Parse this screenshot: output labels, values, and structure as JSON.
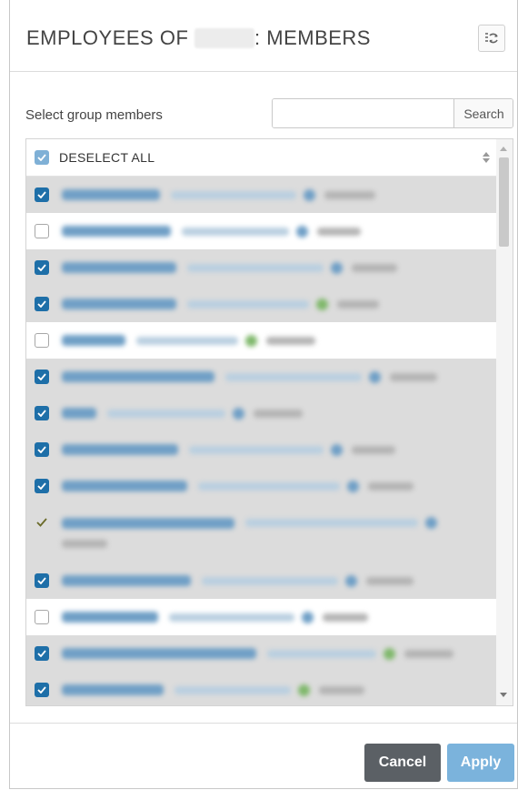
{
  "dialog": {
    "title_prefix": "EMPLOYEES OF",
    "title_suffix": ": MEMBERS",
    "refresh_icon": "refresh-icon"
  },
  "search": {
    "label": "Select group members",
    "placeholder": "",
    "value": "",
    "button_label": "Search"
  },
  "list": {
    "header_label": "DESELECT ALL",
    "header_checkbox": "checked",
    "sort_icon": "sort-icon",
    "rows": [
      {
        "state": "checked"
      },
      {
        "state": "unchecked"
      },
      {
        "state": "checked"
      },
      {
        "state": "checked"
      },
      {
        "state": "unchecked"
      },
      {
        "state": "checked"
      },
      {
        "state": "checked"
      },
      {
        "state": "checked"
      },
      {
        "state": "checked"
      },
      {
        "state": "partial"
      },
      {
        "state": "checked"
      },
      {
        "state": "unchecked"
      },
      {
        "state": "checked"
      },
      {
        "state": "checked"
      }
    ]
  },
  "footer": {
    "cancel_label": "Cancel",
    "apply_label": "Apply"
  },
  "colors": {
    "accent": "#1e6fa8",
    "apply": "#7bb3dc",
    "cancel": "#5b6065",
    "row_selected": "#dcdcdc"
  }
}
